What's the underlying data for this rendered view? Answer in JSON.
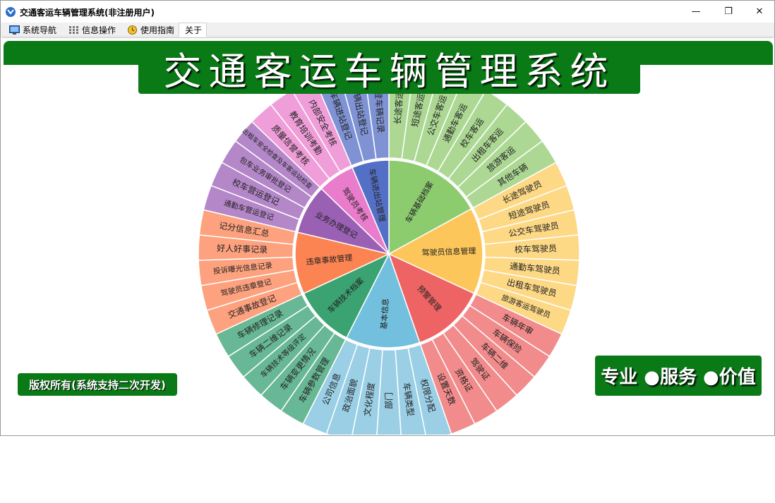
{
  "window": {
    "title": "交通客运车辆管理系统(非注册用户)",
    "minimize": "—",
    "restore": "❐",
    "close": "✕"
  },
  "menu": {
    "items": [
      {
        "label": "系统导航",
        "icon": "monitor-icon"
      },
      {
        "label": "信息操作",
        "icon": "grid-icon"
      },
      {
        "label": "使用指南",
        "icon": "clock-icon"
      },
      {
        "label": "关于",
        "icon": ""
      }
    ]
  },
  "banner": {
    "title": "交通客运车辆管理系统"
  },
  "footer": {
    "copyright": "版权所有(系统支持二次开发)",
    "slogan": "专业 ●服务 ●价值"
  },
  "colors": {
    "brand_green": "#0a7a16"
  },
  "wheel": {
    "inner": [
      {
        "label": "车辆基础档案",
        "color": "#8ccb6e",
        "outer_color": "#acd894",
        "children": [
          "长途客运",
          "短途客运",
          "公交车客运",
          "通勤车客运",
          "校车客运",
          "出租车客运",
          "旅游客运",
          "其他车辆"
        ]
      },
      {
        "label": "驾驶员信息管理",
        "color": "#fcc65a",
        "outer_color": "#fdd885",
        "children": [
          "长途驾驶员",
          "短途驾驶员",
          "公交车驾驶员",
          "校车驾驶员",
          "通勤车驾驶员",
          "出租车驾驶员",
          "旅游客运驾驶员"
        ]
      },
      {
        "label": "预警管理",
        "color": "#ee6464",
        "outer_color": "#f28b8b",
        "children": [
          "车辆年审",
          "车辆保险",
          "车辆二维",
          "驾驶证",
          "资格证",
          "设置天数"
        ]
      },
      {
        "label": "基本信息",
        "color": "#73c0de",
        "outer_color": "#9acfe6",
        "children": [
          "权限分配",
          "车辆类型",
          "部门",
          "文化程度",
          "政治面貌",
          "公司信息"
        ]
      },
      {
        "label": "车辆技术档案",
        "color": "#3ba272",
        "outer_color": "#68b895",
        "children": [
          "车辆参数管理",
          "车辆变更情况",
          "车辆技术等级评定",
          "车辆二维记录",
          "车辆修理记录"
        ]
      },
      {
        "label": "违章事故管理",
        "color": "#fc8452",
        "outer_color": "#fda17e",
        "children": [
          "交通事故登记",
          "驾驶员违章登记",
          "投诉曝光信息记录",
          "好人好事记录",
          "记分信息汇总"
        ]
      },
      {
        "label": "业务办理登记",
        "color": "#9a60b4",
        "outer_color": "#b487c9",
        "children": [
          "通勤车营运登记",
          "校车营运登记",
          "包车业务审批登记",
          "出租车安全检查及车客运站检查"
        ]
      },
      {
        "label": "驾驶员考核",
        "color": "#ea7ccc",
        "outer_color": "#f09ed9",
        "children": [
          "质量信誉考核",
          "教育培训考勤",
          "内部安全考核"
        ]
      },
      {
        "label": "车辆进出站管理",
        "color": "#5470c6",
        "outer_color": "#7f93d4",
        "children": [
          "车辆进站登记",
          "车辆出站登记",
          "已登车辆记录"
        ]
      }
    ]
  }
}
